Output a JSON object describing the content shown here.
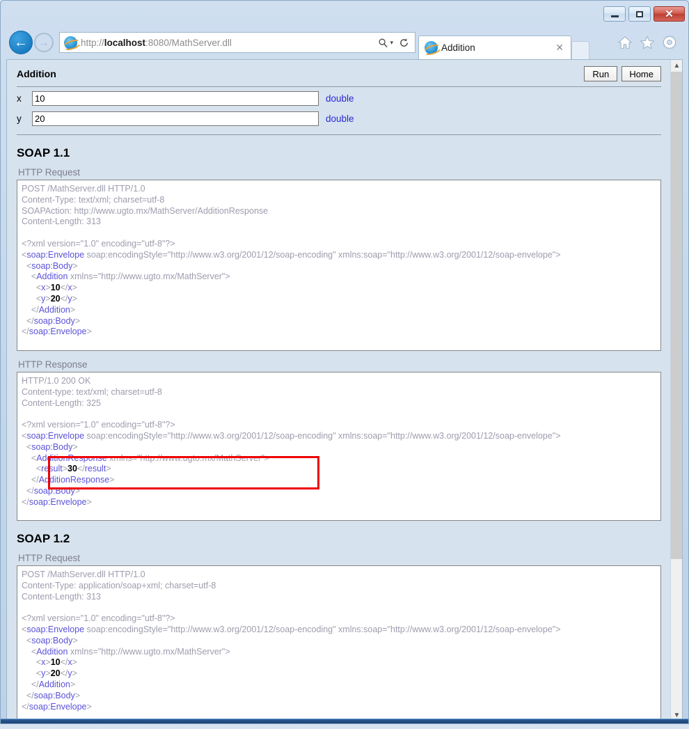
{
  "window": {
    "buttons": {
      "minimize": "minimize-button",
      "restore": "restore-button",
      "close": "✕"
    }
  },
  "browser": {
    "url_prefix": "http://",
    "url_host": "localhost",
    "url_suffix": ":8080/MathServer.dll",
    "url_full": "http://localhost:8080/MathServer.dll",
    "back_glyph": "←",
    "forward_glyph": "→",
    "search_glyph": "⌕",
    "search_dropdown_glyph": "▾",
    "refresh_glyph": "↻",
    "tab_title": "Addition",
    "tab_close_glyph": "✕",
    "home_glyph": "⌂",
    "favorites_glyph": "★",
    "settings_glyph": "⚙"
  },
  "page": {
    "title": "Addition",
    "buttons": {
      "run": "Run",
      "home": "Home"
    },
    "params": [
      {
        "label": "x",
        "value": "10",
        "type": "double"
      },
      {
        "label": "y",
        "value": "20",
        "type": "double"
      }
    ],
    "sections": [
      {
        "heading": "SOAP 1.1",
        "request_label": "HTTP Request",
        "request_headers": [
          "POST /MathServer.dll HTTP/1.0",
          "Content-Type: text/xml; charset=utf-8",
          "SOAPAction: http://www.ugto.mx/MathServer/AdditionResponse",
          "Content-Length: 313"
        ],
        "request_xml_decl": "<?xml version=\"1.0\" encoding=\"utf-8\"?>",
        "response_label": "HTTP Response",
        "response_headers": [
          "HTTP/1.0 200 OK",
          "Content-type: text/xml; charset=utf-8",
          "Content-Length: 325"
        ],
        "response_xml_decl": "<?xml version=\"1.0\" encoding=\"utf-8\"?>"
      },
      {
        "heading": "SOAP 1.2",
        "request_label": "HTTP Request",
        "request_headers": [
          "POST /MathServer.dll HTTP/1.0",
          "Content-Type: application/soap+xml; charset=utf-8",
          "Content-Length: 313"
        ],
        "request_xml_decl": "<?xml version=\"1.0\" encoding=\"utf-8\"?>"
      }
    ],
    "xml": {
      "envelope_open_tag": "soap:Envelope",
      "envelope_attrs": " soap:encodingStyle=\"http://www.w3.org/2001/12/soap-encoding\" xmlns:soap=\"http://www.w3.org/2001/12/soap-envelope\"",
      "body_tag": "soap:Body",
      "addition_tag": "Addition",
      "addition_attrs": " xmlns=\"http://www.ugto.mx/MathServer\"",
      "x_tag": "x",
      "x_value": "10",
      "y_tag": "y",
      "y_value": "20",
      "response_tag": "AdditionResponse",
      "response_attrs": " xmlns=\"http://www.ugto.mx/MathServer\"",
      "result_tag": "result",
      "result_value": "30"
    },
    "highlight_color": "#ee0000"
  }
}
